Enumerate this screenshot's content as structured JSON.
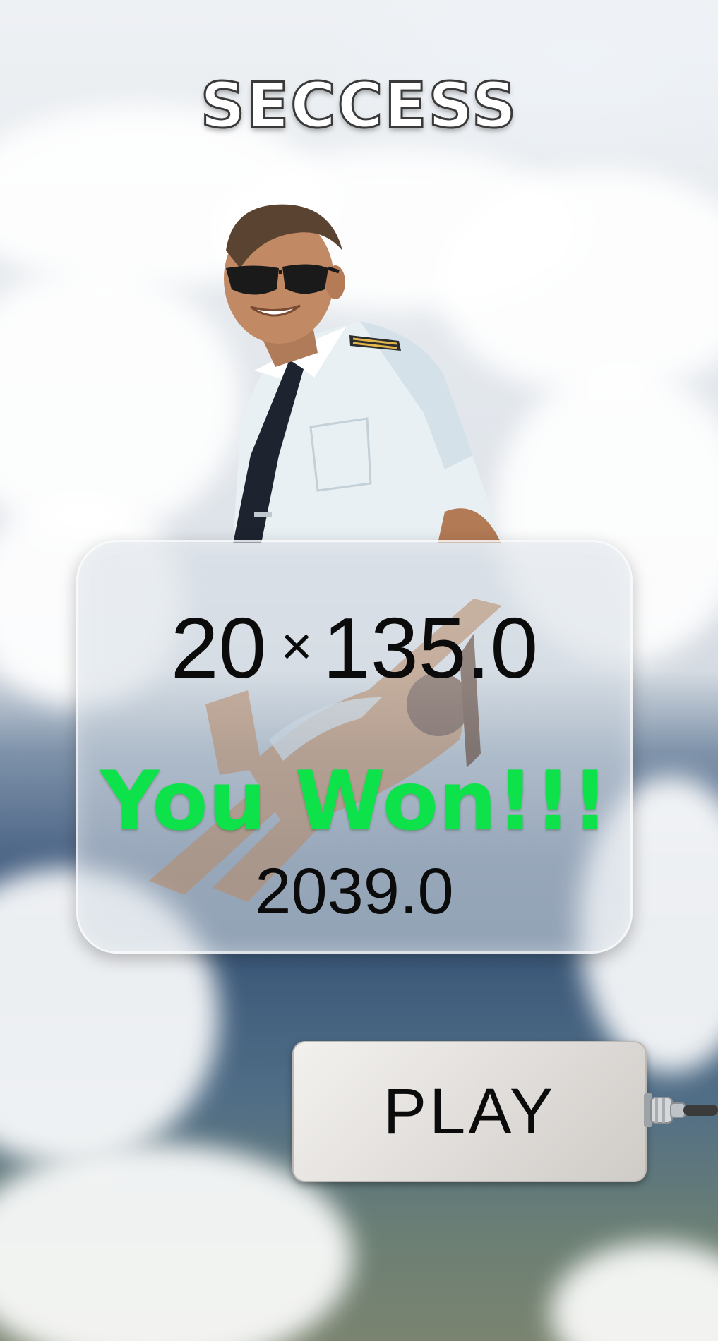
{
  "title": "SECCESS",
  "result": {
    "bet": "20",
    "multiply_symbol": "×",
    "multiplier": "135.0",
    "status_message": "You Won!!!",
    "winnings": "2039.0"
  },
  "actions": {
    "play_label": "PLAY"
  },
  "colors": {
    "win_text": "#0ee24a",
    "panel_bg": "rgba(215,222,230,0.55)",
    "button_bg": "#e3e0dd"
  },
  "icons": {
    "pilot": "pilot-illustration",
    "plane": "biplane-icon",
    "connector": "cable-connector-icon"
  }
}
